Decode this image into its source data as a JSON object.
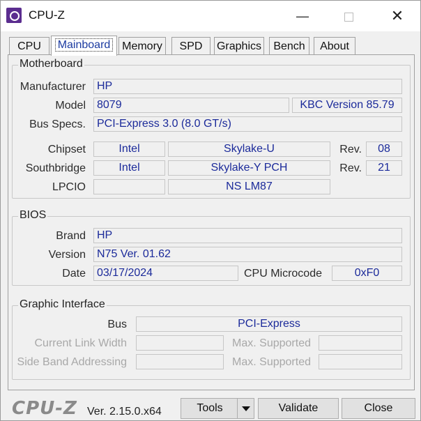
{
  "window": {
    "title": "CPU-Z"
  },
  "tabs": [
    {
      "label": "CPU"
    },
    {
      "label": "Mainboard"
    },
    {
      "label": "Memory"
    },
    {
      "label": "SPD"
    },
    {
      "label": "Graphics"
    },
    {
      "label": "Bench"
    },
    {
      "label": "About"
    }
  ],
  "active_tab": "Mainboard",
  "motherboard": {
    "title": "Motherboard",
    "manufacturer_label": "Manufacturer",
    "manufacturer": "HP",
    "model_label": "Model",
    "model": "8079",
    "model_extra": "KBC Version 85.79",
    "bus_label": "Bus Specs.",
    "bus": "PCI-Express 3.0 (8.0 GT/s)",
    "chipset_label": "Chipset",
    "chipset_vendor": "Intel",
    "chipset_name": "Skylake-U",
    "chipset_rev_label": "Rev.",
    "chipset_rev": "08",
    "southbridge_label": "Southbridge",
    "southbridge_vendor": "Intel",
    "southbridge_name": "Skylake-Y PCH",
    "southbridge_rev_label": "Rev.",
    "southbridge_rev": "21",
    "lpcio_label": "LPCIO",
    "lpcio_vendor": "",
    "lpcio_name": "NS LM87"
  },
  "bios": {
    "title": "BIOS",
    "brand_label": "Brand",
    "brand": "HP",
    "version_label": "Version",
    "version": "N75 Ver. 01.62",
    "date_label": "Date",
    "date": "03/17/2024",
    "microcode_label": "CPU Microcode",
    "microcode": "0xF0"
  },
  "graphic_interface": {
    "title": "Graphic Interface",
    "bus_label": "Bus",
    "bus": "PCI-Express",
    "link_width_label": "Current Link Width",
    "link_width": "",
    "max_supported_label_1": "Max. Supported",
    "max_supported_1": "",
    "side_band_label": "Side Band Addressing",
    "side_band": "",
    "max_supported_label_2": "Max. Supported",
    "max_supported_2": ""
  },
  "footer": {
    "logo": "CPU-Z",
    "version": "Ver. 2.15.0.x64",
    "tools_label": "Tools",
    "validate_label": "Validate",
    "close_label": "Close"
  },
  "icons": [
    "cpuz-app-icon",
    "minimize-icon",
    "maximize-icon",
    "close-icon",
    "chevron-down-icon"
  ]
}
